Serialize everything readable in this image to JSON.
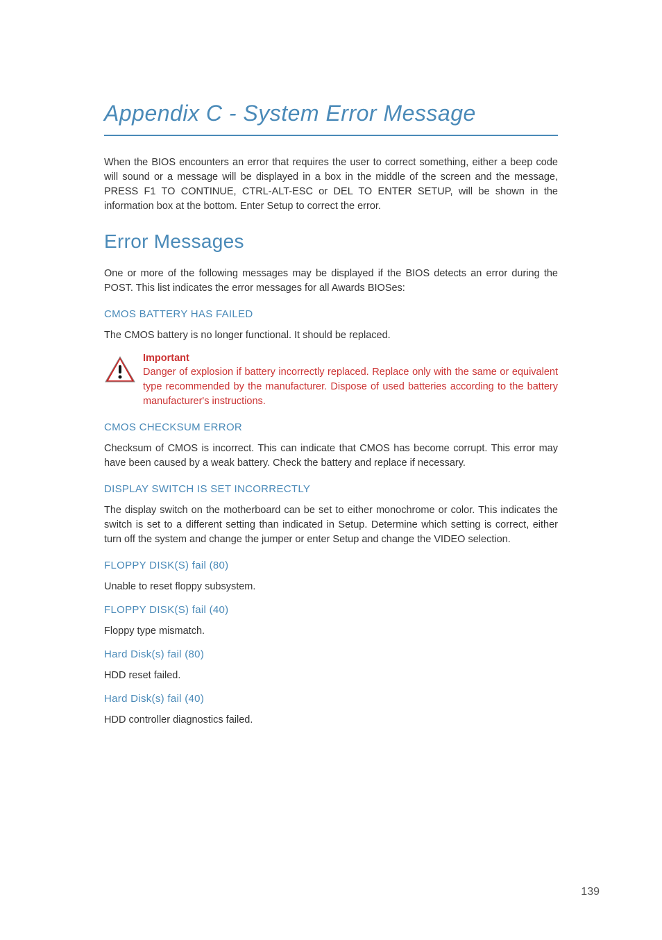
{
  "appendix": {
    "title": "Appendix C - System Error Message",
    "intro": "When the BIOS encounters an error that requires the user to correct something, either a beep code will sound or a message will be displayed in a box in the middle of the screen and the message, PRESS F1 TO CONTINUE, CTRL-ALT-ESC or DEL TO ENTER SETUP, will be shown in the information box at the bottom. Enter Setup to correct the error."
  },
  "section": {
    "title": "Error Messages",
    "intro": "One or more of the following messages may be displayed if the BIOS detects an error during the POST. This list indicates the error messages for all Awards BIOSes:"
  },
  "errors": {
    "cmos_battery": {
      "title": "CMOS BATTERY HAS FAILED",
      "body": "The CMOS battery is no longer functional. It should be replaced."
    },
    "note": {
      "title": "Important",
      "body": "Danger of explosion if battery incorrectly replaced. Replace only with the same or equivalent type recommended by the manufacturer. Dispose of used batteries according to the battery manufacturer's instructions."
    },
    "cmos_checksum": {
      "title": "CMOS CHECKSUM ERROR",
      "body": "Checksum of CMOS is incorrect. This can indicate that CMOS has become corrupt. This error may have been caused by a weak battery. Check the battery and replace if necessary."
    },
    "display_switch": {
      "title": "DISPLAY SWITCH IS SET INCORRECTLY",
      "body": "The display switch on the motherboard can be set to either monochrome or color. This indicates the switch is set to a different setting than indicated in Setup. Determine which setting is correct, either turn off the system and change the jumper or enter Setup and change the VIDEO selection."
    },
    "floppy80": {
      "title": "FLOPPY DISK(S) fail (80)",
      "body": "Unable to reset floppy subsystem."
    },
    "floppy40": {
      "title": "FLOPPY DISK(S) fail (40)",
      "body": "Floppy type mismatch."
    },
    "hd80": {
      "title": "Hard Disk(s) fail (80)",
      "body": "HDD reset failed."
    },
    "hd40": {
      "title": "Hard Disk(s) fail (40)",
      "body": "HDD controller diagnostics failed."
    }
  },
  "page_number": "139"
}
